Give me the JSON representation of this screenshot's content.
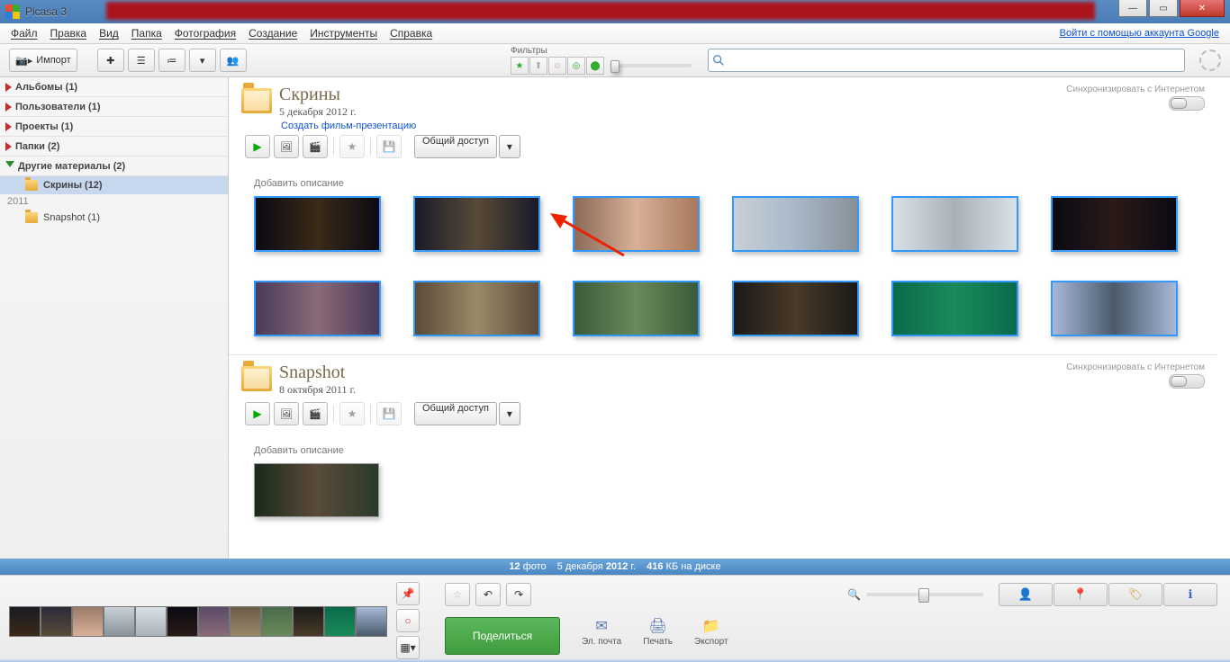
{
  "title": "Picasa 3",
  "menu": {
    "file": "Файл",
    "edit": "Правка",
    "view": "Вид",
    "folder": "Папка",
    "photo": "Фотография",
    "create": "Создание",
    "tools": "Инструменты",
    "help": "Справка"
  },
  "google_login": "Войти с помощью аккаунта Google",
  "import_btn": "Импорт",
  "filters_label": "Фильтры",
  "sidebar": {
    "items": [
      {
        "label": "Альбомы (1)"
      },
      {
        "label": "Пользователи (1)"
      },
      {
        "label": "Проекты (1)"
      },
      {
        "label": "Папки (2)"
      },
      {
        "label": "Другие материалы (2)"
      }
    ],
    "year": "2011",
    "folders": [
      {
        "label": "Скрины (12)",
        "selected": true
      },
      {
        "label": "Snapshot (1)",
        "selected": false
      }
    ]
  },
  "folder1": {
    "title": "Скрины",
    "date_prefix": "5 ",
    "date_month": "декабря",
    "date_year": " 2012 г.",
    "film_link": "Создать фильм-презентацию",
    "sync_text": "Синхронизировать с Интернетом",
    "share": "Общий доступ",
    "add_desc": "Добавить описание"
  },
  "folder2": {
    "title": "Snapshot",
    "date_prefix": "8 ",
    "date_month": "октября",
    "date_year": " 2011 г.",
    "sync_text": "Синхронизировать с Интернетом",
    "share": "Общий доступ",
    "add_desc": "Добавить описание"
  },
  "status": {
    "count": "12",
    "count_unit": " фото",
    "date_d": "5 декабря ",
    "date_y": "2012",
    " date_suffix": " г.",
    "size": "416",
    "size_unit": " КБ на диске"
  },
  "bottom": {
    "share": "Поделиться",
    "email": "Эл. почта",
    "print": "Печать",
    "export": "Экспорт"
  }
}
